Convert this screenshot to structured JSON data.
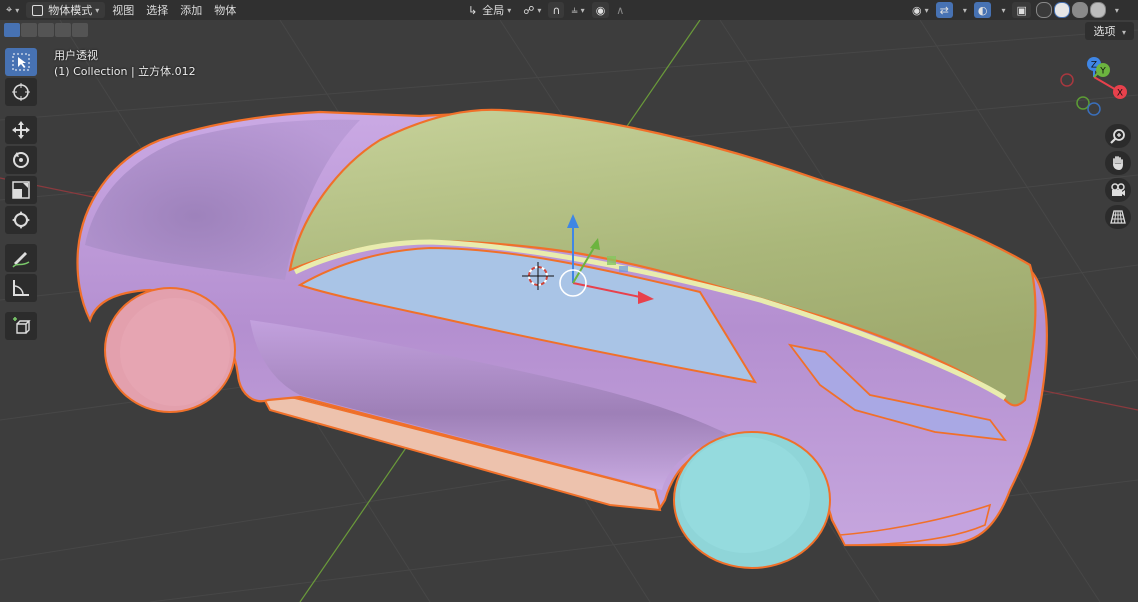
{
  "header": {
    "mode_label": "物体模式",
    "menu": [
      "视图",
      "选择",
      "添加",
      "物体"
    ],
    "orientation_label": "全局"
  },
  "options_label": "选项",
  "viewport_info": {
    "view_name": "用户透视",
    "collection_text": "(1) Collection | 立方体.012"
  },
  "gizmo": {
    "x_label": "X",
    "y_label": "Y",
    "z_label": "Z",
    "x_color": "#e8414c",
    "y_color": "#6cb43f",
    "z_color": "#3f86e5"
  },
  "tools": [
    "select-box-icon",
    "cursor-icon",
    "move-icon",
    "rotate-icon",
    "scale-icon",
    "transform-icon",
    "annotate-icon",
    "measure-icon",
    "add-cube-icon"
  ],
  "nav_buttons": [
    "zoom-icon",
    "pan-hand-icon",
    "camera-icon",
    "perspective-grid-icon"
  ],
  "colors": {
    "body_purple": "#c4a3df",
    "roof_green": "#b9c58c",
    "glass_blue": "#a9c4e6",
    "wheel_front": "#e3a0ad",
    "wheel_rear": "#8fd5d8",
    "outline": "#f0702a",
    "accent": "#4772b3"
  }
}
